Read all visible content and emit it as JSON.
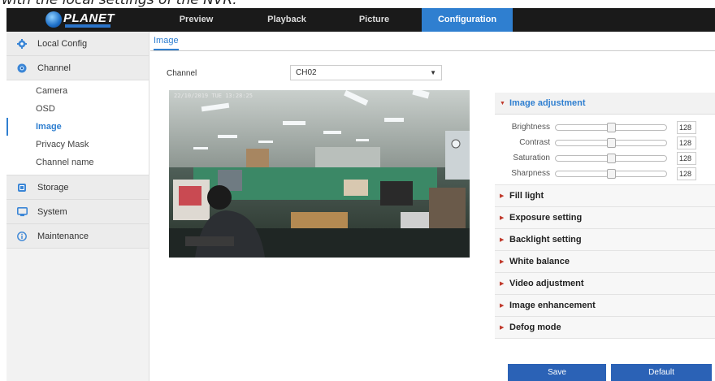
{
  "caption": "with the local settings of the NVR.",
  "brand": {
    "name": "PLANET"
  },
  "nav": {
    "tabs": [
      {
        "label": "Preview",
        "active": false
      },
      {
        "label": "Playback",
        "active": false
      },
      {
        "label": "Picture",
        "active": false
      },
      {
        "label": "Configuration",
        "active": true
      }
    ]
  },
  "sidebar": {
    "groups": [
      {
        "label": "Local Config",
        "icon": "gear-icon"
      },
      {
        "label": "Channel",
        "icon": "camera-icon",
        "items": [
          {
            "label": "Camera",
            "active": false
          },
          {
            "label": "OSD",
            "active": false
          },
          {
            "label": "Image",
            "active": true
          },
          {
            "label": "Privacy Mask",
            "active": false
          },
          {
            "label": "Channel name",
            "active": false
          }
        ]
      },
      {
        "label": "Storage",
        "icon": "storage-icon"
      },
      {
        "label": "System",
        "icon": "monitor-icon"
      },
      {
        "label": "Maintenance",
        "icon": "info-icon"
      }
    ]
  },
  "main": {
    "breadcrumb": "Image",
    "channel_label": "Channel",
    "channel_value": "CH02",
    "timestamp": "22/10/2019 TUE 13:28:25"
  },
  "panel": {
    "open_section": "Image adjustment",
    "adjustments": [
      {
        "name": "Brightness",
        "value": "128",
        "level": 0.5
      },
      {
        "name": "Contrast",
        "value": "128",
        "level": 0.5
      },
      {
        "name": "Saturation",
        "value": "128",
        "level": 0.5
      },
      {
        "name": "Sharpness",
        "value": "128",
        "level": 0.5
      }
    ],
    "sections": [
      "Fill light",
      "Exposure setting",
      "Backlight setting",
      "White balance",
      "Video adjustment",
      "Image enhancement",
      "Defog mode"
    ]
  },
  "buttons": {
    "save": "Save",
    "default": "Default"
  },
  "colors": {
    "accent": "#2f7fd0",
    "button": "#2b62b6",
    "topbar": "#1a1a1a",
    "marker": "#c0392b"
  }
}
